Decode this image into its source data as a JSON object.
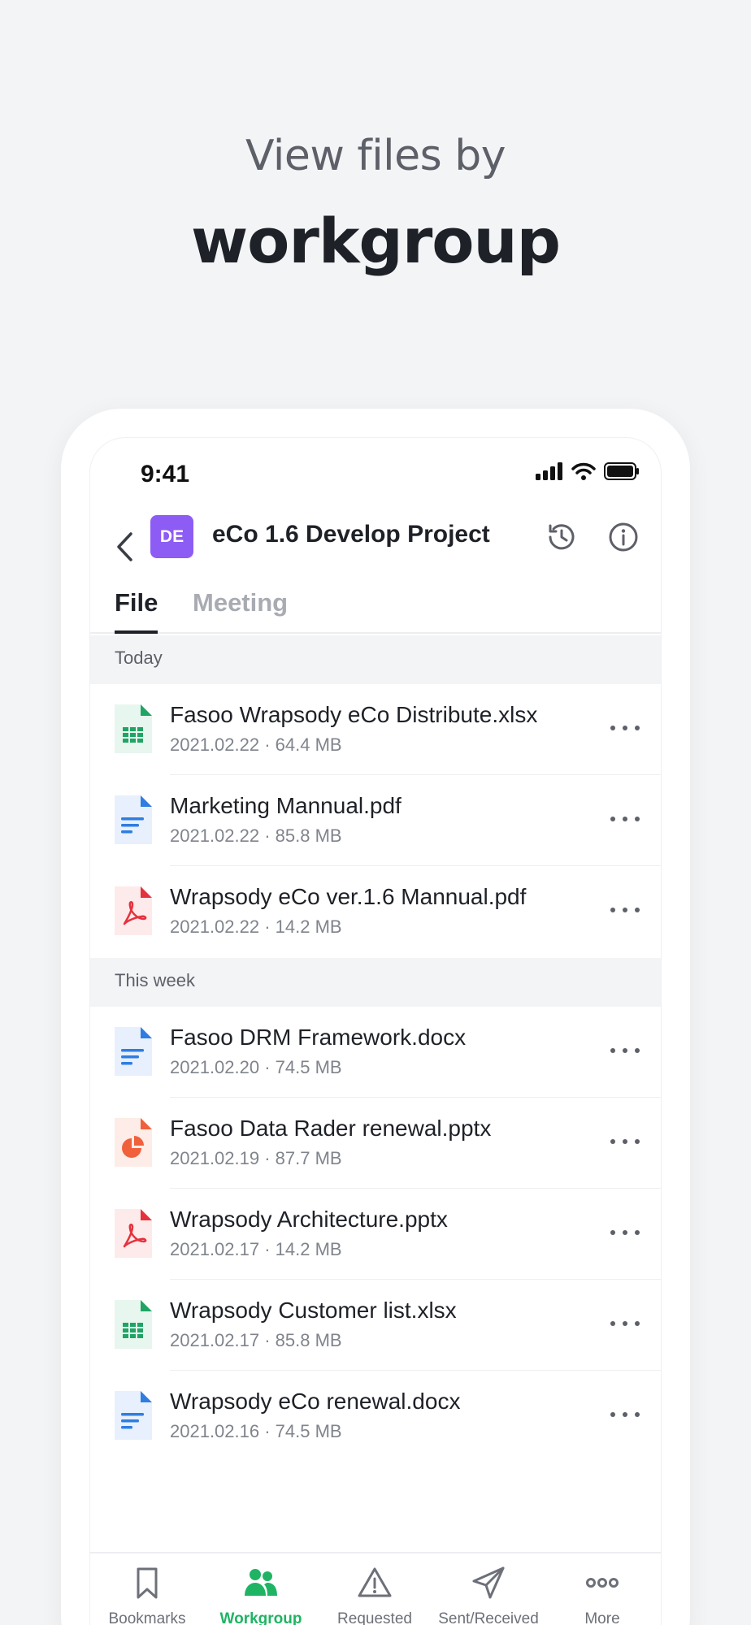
{
  "promo": {
    "subtitle": "View files by",
    "title": "workgroup"
  },
  "status_bar": {
    "time": "9:41"
  },
  "header": {
    "project_badge": "DE",
    "project_title": "eCo 1.6 Develop Project",
    "badge_color": "#8c5cf5"
  },
  "tabs": {
    "file": "File",
    "meeting": "Meeting",
    "active": "File"
  },
  "sections": [
    {
      "label": "Today",
      "files": [
        {
          "name": "Fasoo Wrapsody eCo Distribute.xlsx",
          "meta": "2021.02.22 · 64.4 MB",
          "type": "xlsx"
        },
        {
          "name": "Marketing Mannual.pdf",
          "meta": "2021.02.22 · 85.8 MB",
          "type": "doc"
        },
        {
          "name": "Wrapsody eCo ver.1.6 Mannual.pdf",
          "meta": "2021.02.22 · 14.2 MB",
          "type": "pdf"
        }
      ]
    },
    {
      "label": "This week",
      "files": [
        {
          "name": "Fasoo DRM Framework.docx",
          "meta": "2021.02.20 · 74.5 MB",
          "type": "doc"
        },
        {
          "name": "Fasoo Data Rader renewal.pptx",
          "meta": "2021.02.19 · 87.7 MB",
          "type": "pptx"
        },
        {
          "name": "Wrapsody Architecture.pptx",
          "meta": "2021.02.17 · 14.2 MB",
          "type": "pdf"
        },
        {
          "name": "Wrapsody Customer list.xlsx",
          "meta": "2021.02.17 · 85.8 MB",
          "type": "xlsx"
        },
        {
          "name": "Wrapsody eCo renewal.docx",
          "meta": "2021.02.16 · 74.5 MB",
          "type": "doc"
        }
      ]
    }
  ],
  "bottom_nav": [
    {
      "label": "Bookmarks",
      "icon": "bookmark-icon",
      "active": false
    },
    {
      "label": "Workgroup",
      "icon": "people-icon",
      "active": true
    },
    {
      "label": "Requested",
      "icon": "warning-icon",
      "active": false
    },
    {
      "label": "Sent/Received",
      "icon": "send-icon",
      "active": false
    },
    {
      "label": "More",
      "icon": "more-icon",
      "active": false
    }
  ],
  "colors": {
    "accent": "#1fb463",
    "xlsx": "#20a464",
    "doc": "#2f7de1",
    "pdf": "#e5323e",
    "pptx": "#f0603d"
  }
}
